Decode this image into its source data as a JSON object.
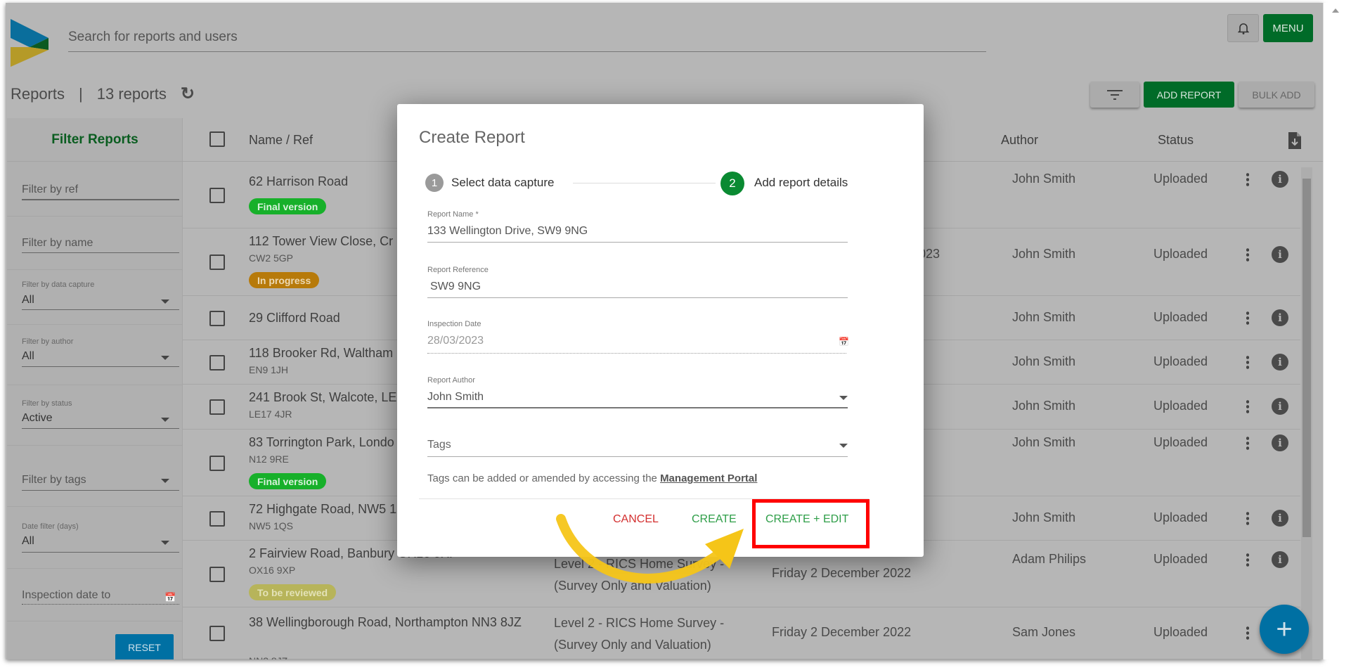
{
  "header": {
    "search_placeholder": "Search for reports and users",
    "menu_label": "MENU",
    "bell_icon": "bell-icon"
  },
  "toolbar": {
    "title": "Reports",
    "separator": "|",
    "count": "13 reports",
    "add_report": "ADD REPORT",
    "bulk_add": "BULK ADD"
  },
  "colors": {
    "brand_green": "#006b28",
    "blue": "#0070a3",
    "cancel_red": "#d32f2f",
    "action_green": "#2e9e48",
    "highlight_red": "#ff0000",
    "arrow_yellow": "#f5c518"
  },
  "sidebar": {
    "title": "Filter Reports",
    "filter_ref": "Filter by ref",
    "filter_name": "Filter by name",
    "data_capture_label": "Filter by data capture",
    "data_capture_value": "All",
    "author_label": "Filter by author",
    "author_value": "All",
    "status_label": "Filter by status",
    "status_value": "Active",
    "tags": "Filter by tags",
    "date_label": "Date filter (days)",
    "date_value": "All",
    "inspection_to": "Inspection date to",
    "reset": "RESET"
  },
  "table": {
    "headers": {
      "name": "Name / Ref",
      "author": "Author",
      "status": "Status"
    },
    "rows": [
      {
        "name": "62 Harrison Road",
        "ref": "",
        "badge": "Final version",
        "badge_type": "final",
        "capture": "",
        "date": "",
        "author": "John Smith",
        "status": "Uploaded"
      },
      {
        "name": "112 Tower View Close, Cr",
        "ref": "CW2 5GP",
        "badge": "In progress",
        "badge_type": "progress",
        "capture": "",
        "date": "023",
        "author": "John Smith",
        "status": "Uploaded"
      },
      {
        "name": "29 Clifford Road",
        "ref": "",
        "badge": "",
        "capture": "",
        "date": "",
        "author": "John Smith",
        "status": "Uploaded"
      },
      {
        "name": "118 Brooker Rd, Waltham",
        "ref": "EN9 1JH",
        "badge": "",
        "capture": "",
        "date": "",
        "author": "John Smith",
        "status": "Uploaded"
      },
      {
        "name": "241 Brook St, Walcote, LE",
        "ref": "LE17 4JR",
        "badge": "",
        "capture": "",
        "date": "",
        "author": "John Smith",
        "status": "Uploaded"
      },
      {
        "name": "83 Torrington Park, Londo",
        "ref": "N12 9RE",
        "badge": "Final version",
        "badge_type": "final",
        "capture": "",
        "date": "",
        "author": "John Smith",
        "status": "Uploaded"
      },
      {
        "name": "72 Highgate Road, NW5 1",
        "ref": "NW5 1QS",
        "badge": "",
        "capture": "",
        "date": "",
        "author": "John Smith",
        "status": "Uploaded"
      },
      {
        "name": "2 Fairview Road, Banbury OX16 9XP",
        "ref": "OX16 9XP",
        "badge": "To be reviewed",
        "badge_type": "review",
        "capture": "Level 2 - RICS Home Survey - (Survey Only and Valuation)",
        "date": "Friday 2 December 2022",
        "author": "Adam Philips",
        "status": "Uploaded"
      },
      {
        "name": "38 Wellingborough Road, Northampton NN3 8JZ",
        "ref": "NN3 8JZ",
        "badge": "",
        "capture": "Level 2 - RICS Home Survey - (Survey Only and Valuation)",
        "date": "Friday 2 December 2022",
        "author": "Sam Jones",
        "status": "Uploaded"
      }
    ]
  },
  "dialog": {
    "title": "Create Report",
    "steps": [
      {
        "num": "1",
        "label": "Select data capture",
        "state": "done"
      },
      {
        "num": "2",
        "label": "Add report details",
        "state": "active"
      }
    ],
    "report_name_label": "Report Name *",
    "report_name": "133 Wellington Drive, SW9 9NG",
    "report_ref_label": "Report Reference",
    "report_ref": "SW9 9NG",
    "inspection_label": "Inspection Date",
    "inspection_date": "28/03/2023",
    "author_label": "Report Author",
    "author": "John Smith",
    "tags_placeholder": "Tags",
    "help_text": "Tags can be added or amended by accessing the ",
    "help_link": "Management Portal",
    "cancel": "CANCEL",
    "create": "CREATE",
    "create_edit": "CREATE + EDIT"
  }
}
